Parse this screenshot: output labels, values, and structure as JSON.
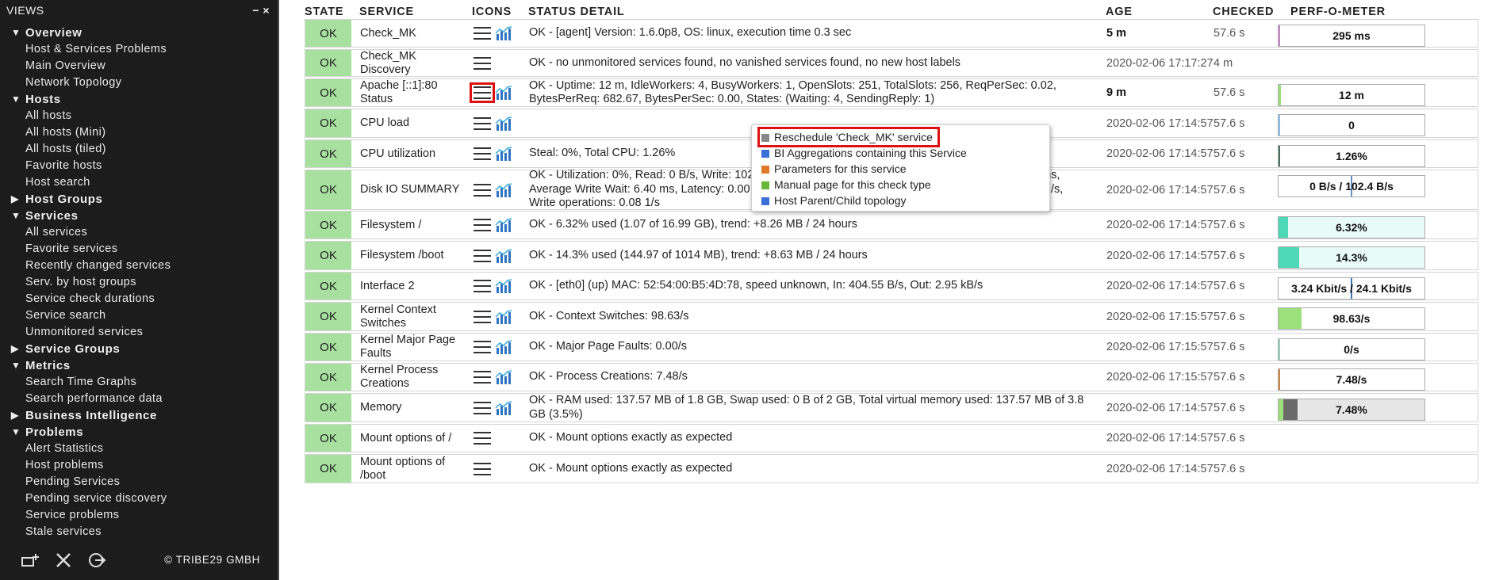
{
  "sidebar": {
    "title": "VIEWS",
    "header_controls": [
      "−",
      "×"
    ],
    "sections": [
      {
        "label": "Overview",
        "expanded": true,
        "items": [
          "Host & Services Problems",
          "Main Overview",
          "Network Topology"
        ]
      },
      {
        "label": "Hosts",
        "expanded": true,
        "items": [
          "All hosts",
          "All hosts (Mini)",
          "All hosts (tiled)",
          "Favorite hosts",
          "Host search"
        ]
      },
      {
        "label": "Host Groups",
        "expanded": false,
        "items": []
      },
      {
        "label": "Services",
        "expanded": true,
        "items": [
          "All services",
          "Favorite services",
          "Recently changed services",
          "Serv. by host groups",
          "Service check durations",
          "Service search",
          "Unmonitored services"
        ]
      },
      {
        "label": "Service Groups",
        "expanded": false,
        "items": []
      },
      {
        "label": "Metrics",
        "expanded": true,
        "items": [
          "Search Time Graphs",
          "Search performance data"
        ]
      },
      {
        "label": "Business Intelligence",
        "expanded": false,
        "items": []
      },
      {
        "label": "Problems",
        "expanded": true,
        "items": [
          "Alert Statistics",
          "Host problems",
          "Pending Services",
          "Pending service discovery",
          "Service problems",
          "Stale services"
        ]
      }
    ],
    "copyright": "© TRIBE29 GMBH"
  },
  "table": {
    "headers": {
      "state": "STATE",
      "service": "SERVICE",
      "icons": "ICONS",
      "status_detail": "STATUS DETAIL",
      "age": "AGE",
      "checked": "CHECKED",
      "perf": "PERF-O-METER"
    },
    "rows": [
      {
        "state": "OK",
        "service": "Check_MK",
        "graph": true,
        "detail": "OK - [agent] Version: 1.6.0p8, OS: linux, execution time 0.3 sec",
        "age": "5 m",
        "age_bold": true,
        "checked": "57.6 s",
        "perf": {
          "label": "295 ms",
          "fill": 0.01,
          "color": "#c688cc"
        }
      },
      {
        "state": "OK",
        "service": "Check_MK Discovery",
        "graph": false,
        "detail": "OK - no unmonitored services found, no vanished services found, no new host labels",
        "age": "2020-02-06 17:17:27",
        "age_bold": false,
        "checked": "4 m",
        "perf": null
      },
      {
        "state": "OK",
        "service": "Apache [::1]:80 Status",
        "graph": true,
        "menu_open": true,
        "detail": "OK - Uptime: 12 m, IdleWorkers: 4, BusyWorkers: 1, OpenSlots: 251, TotalSlots: 256, ReqPerSec: 0.02, BytesPerReq: 682.67, BytesPerSec: 0.00, States: (Waiting: 4, SendingReply: 1)",
        "age": "9 m",
        "age_bold": true,
        "checked": "57.6 s",
        "perf": {
          "label": "12 m",
          "fill": 0.015,
          "color": "#9be07a"
        }
      },
      {
        "state": "OK",
        "service": "CPU load",
        "graph": true,
        "detail": "",
        "age": "2020-02-06 17:14:57",
        "age_bold": false,
        "checked": "57.6 s",
        "perf": {
          "label": "0",
          "fill": 0.005,
          "color": "#88c0e8"
        }
      },
      {
        "state": "OK",
        "service": "CPU utilization",
        "graph": true,
        "detail": "Steal: 0%, Total CPU: 1.26%",
        "age": "2020-02-06 17:14:57",
        "age_bold": false,
        "checked": "57.6 s",
        "perf": {
          "label": "1.26%",
          "fill": 0.0126,
          "color": "#4a7060"
        }
      },
      {
        "state": "OK",
        "service": "Disk IO SUMMARY",
        "graph": true,
        "detail": "OK - Utilization: 0%, Read: 0 B/s, Write: 102.4 B/s, Average Wait: 6.40 ms, Average Read Wait: 0.00 ms, Average Write Wait: 6.40 ms, Latency: 0.00 ms, Average Queue Length: 0.00, Read operations: 0.00 1/s, Write operations: 0.08 1/s",
        "age": "2020-02-06 17:14:57",
        "age_bold": false,
        "checked": "57.6 s",
        "perf": {
          "label": "0 B/s / 102.4 B/s",
          "fill": 0.5,
          "color": "#6090c0",
          "split": true
        }
      },
      {
        "state": "OK",
        "service": "Filesystem /",
        "graph": true,
        "detail": "OK - 6.32% used (1.07 of 16.99 GB), trend: +8.26 MB / 24 hours",
        "age": "2020-02-06 17:14:57",
        "age_bold": false,
        "checked": "57.6 s",
        "perf": {
          "label": "6.32%",
          "fill": 0.0632,
          "color": "#4ed8b8",
          "bg": "#e8fbf6"
        }
      },
      {
        "state": "OK",
        "service": "Filesystem /boot",
        "graph": true,
        "detail": "OK - 14.3% used (144.97 of 1014 MB), trend: +8.63 MB / 24 hours",
        "age": "2020-02-06 17:14:57",
        "age_bold": false,
        "checked": "57.6 s",
        "perf": {
          "label": "14.3%",
          "fill": 0.143,
          "color": "#4ed8b8",
          "bg": "#e8fbf6"
        }
      },
      {
        "state": "OK",
        "service": "Interface 2",
        "graph": true,
        "detail": "OK - [eth0] (up) MAC: 52:54:00:B5:4D:78, speed unknown, In: 404.55 B/s, Out: 2.95 kB/s",
        "age": "2020-02-06 17:14:57",
        "age_bold": false,
        "checked": "57.6 s",
        "perf": {
          "label": "3.24 Kbit/s / 24.1 Kbit/s",
          "fill": 0.5,
          "color": "#3a78b0",
          "split": true
        }
      },
      {
        "state": "OK",
        "service": "Kernel Context Switches",
        "graph": true,
        "detail": "OK - Context Switches: 98.63/s",
        "age": "2020-02-06 17:15:57",
        "age_bold": false,
        "checked": "57.6 s",
        "perf": {
          "label": "98.63/s",
          "fill": 0.16,
          "color": "#9be07a"
        }
      },
      {
        "state": "OK",
        "service": "Kernel Major Page Faults",
        "graph": true,
        "detail": "OK - Major Page Faults: 0.00/s",
        "age": "2020-02-06 17:15:57",
        "age_bold": false,
        "checked": "57.6 s",
        "perf": {
          "label": "0/s",
          "fill": 0.005,
          "color": "#9bd0c0"
        }
      },
      {
        "state": "OK",
        "service": "Kernel Process Creations",
        "graph": true,
        "detail": "OK - Process Creations: 7.48/s",
        "age": "2020-02-06 17:15:57",
        "age_bold": false,
        "checked": "57.6 s",
        "perf": {
          "label": "7.48/s",
          "fill": 0.012,
          "color": "#c88848"
        }
      },
      {
        "state": "OK",
        "service": "Memory",
        "graph": true,
        "detail": "OK - RAM used: 137.57 MB of 1.8 GB, Swap used: 0 B of 2 GB, Total virtual memory used: 137.57 MB of 3.8 GB (3.5%)",
        "age": "2020-02-06 17:14:57",
        "age_bold": false,
        "checked": "57.6 s",
        "perf": {
          "label": "7.48%",
          "fill": 0.1,
          "color": "#6a6a6a",
          "bg": "#e6e6e6",
          "memory": true
        }
      },
      {
        "state": "OK",
        "service": "Mount options of /",
        "graph": false,
        "detail": "OK - Mount options exactly as expected",
        "age": "2020-02-06 17:14:57",
        "age_bold": false,
        "checked": "57.6 s",
        "perf": null
      },
      {
        "state": "OK",
        "service": "Mount options of /boot",
        "graph": false,
        "detail": "OK - Mount options exactly as expected",
        "age": "2020-02-06 17:14:57",
        "age_bold": false,
        "checked": "57.6 s",
        "perf": null
      }
    ]
  },
  "popup_menu": {
    "items": [
      {
        "label": "Reschedule 'Check_MK' service",
        "icon": "reschedule-icon",
        "color": "#888888",
        "highlighted": true
      },
      {
        "label": "BI Aggregations containing this Service",
        "icon": "bi-aggregation-icon",
        "color": "#3a6fd8",
        "highlighted": false
      },
      {
        "label": "Parameters for this service",
        "icon": "parameters-icon",
        "color": "#e07a28",
        "highlighted": false
      },
      {
        "label": "Manual page for this check type",
        "icon": "manual-page-icon",
        "color": "#68b838",
        "highlighted": false
      },
      {
        "label": "Host Parent/Child topology",
        "icon": "topology-icon",
        "color": "#3a6fd8",
        "highlighted": false
      }
    ]
  }
}
